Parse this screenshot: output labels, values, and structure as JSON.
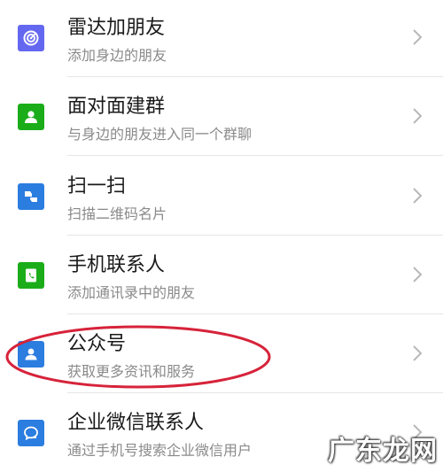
{
  "colors": {
    "radar": "#6467f0",
    "face_group": "#1aad19",
    "scan": "#2b7de0",
    "phone_contacts": "#1aad19",
    "official_accounts": "#2b7de0",
    "wecom": "#2b7de0",
    "annotation_ellipse": "#d6233a"
  },
  "items": [
    {
      "title": "雷达加朋友",
      "subtitle": "添加身边的朋友",
      "icon": "radar-icon"
    },
    {
      "title": "面对面建群",
      "subtitle": "与身边的朋友进入同一个群聊",
      "icon": "face-to-face-group-icon"
    },
    {
      "title": "扫一扫",
      "subtitle": "扫描二维码名片",
      "icon": "scan-icon"
    },
    {
      "title": "手机联系人",
      "subtitle": "添加通讯录中的朋友",
      "icon": "phone-contacts-icon"
    },
    {
      "title": "公众号",
      "subtitle": "获取更多资讯和服务",
      "icon": "official-accounts-icon"
    },
    {
      "title": "企业微信联系人",
      "subtitle": "通过手机号搜索企业微信用户",
      "icon": "wecom-contacts-icon"
    }
  ],
  "watermark": {
    "text": "广东龙网"
  }
}
